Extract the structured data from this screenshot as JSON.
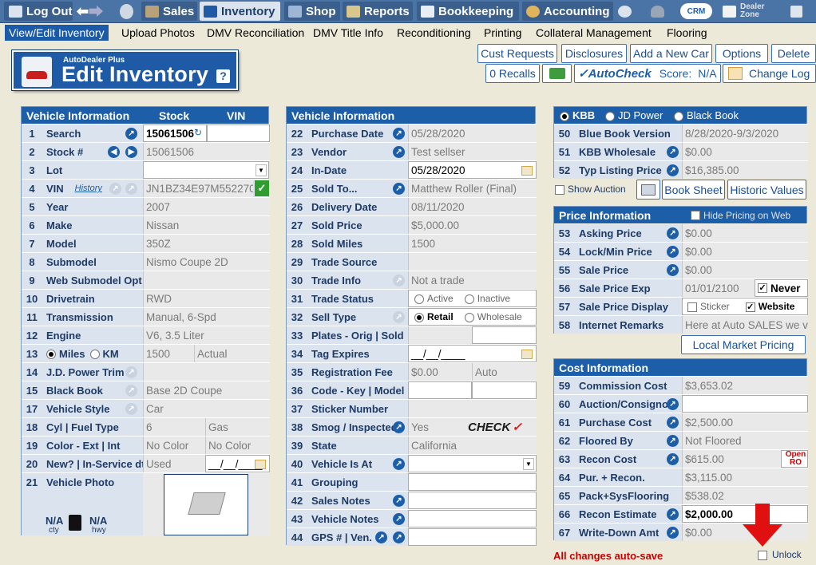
{
  "topnav": {
    "logout": "Log Out",
    "sales": "Sales",
    "inventory": "Inventory",
    "shop": "Shop",
    "reports": "Reports",
    "bookkeeping": "Bookkeeping",
    "accounting": "Accounting",
    "crm": "CRM",
    "dealer_zone": "Dealer Zone"
  },
  "subtabs": [
    "View/Edit Inventory",
    "Upload Photos",
    "DMV Reconciliation",
    "DMV Title Info",
    "Reconditioning",
    "Printing",
    "Collateral Management",
    "Flooring"
  ],
  "logo": {
    "small": "AutoDealer Plus",
    "title": "Edit Inventory",
    "help": "?"
  },
  "actions": {
    "cust_requests": "Cust Requests",
    "disclosures": "Disclosures",
    "add_new_car": "Add a New Car",
    "options": "Options",
    "delete": "Delete",
    "recalls": "0 Recalls",
    "autocheck": "✓AutoCheck",
    "score_label": "Score:",
    "score_value": "N/A",
    "change_log": "Change Log"
  },
  "left": {
    "header": "Vehicle Information",
    "col_stock": "Stock",
    "col_vin": "VIN",
    "history": "History",
    "miles": "Miles",
    "km": "KM",
    "actual": "Actual",
    "mpg_city": "N/A",
    "mpg_city_unit": "cty",
    "mpg_hwy": "N/A",
    "mpg_hwy_unit": "hwy",
    "rows": [
      {
        "n": "1",
        "label": "Search",
        "value": "15061506"
      },
      {
        "n": "2",
        "label": "Stock #",
        "value": "15061506"
      },
      {
        "n": "3",
        "label": "Lot",
        "value": ""
      },
      {
        "n": "4",
        "label": "VIN",
        "value": "JN1BZ34E97M552270"
      },
      {
        "n": "5",
        "label": "Year",
        "value": "2007"
      },
      {
        "n": "6",
        "label": "Make",
        "value": "Nissan"
      },
      {
        "n": "7",
        "label": "Model",
        "value": "350Z"
      },
      {
        "n": "8",
        "label": "Submodel",
        "value": "Nismo Coupe 2D"
      },
      {
        "n": "9",
        "label": "Web Submodel Opt",
        "value": ""
      },
      {
        "n": "10",
        "label": "Drivetrain",
        "value": "RWD"
      },
      {
        "n": "11",
        "label": "Transmission",
        "value": "Manual, 6-Spd"
      },
      {
        "n": "12",
        "label": "Engine",
        "value": "V6, 3.5 Liter"
      },
      {
        "n": "13",
        "label": "",
        "value": "1500"
      },
      {
        "n": "14",
        "label": "J.D. Power Trim",
        "value": ""
      },
      {
        "n": "15",
        "label": "Black Book",
        "value": "Base 2D Coupe"
      },
      {
        "n": "17",
        "label": "Vehicle Style",
        "value": "Car"
      },
      {
        "n": "18",
        "label": "Cyl | Fuel Type",
        "value": "6",
        "value2": "Gas"
      },
      {
        "n": "19",
        "label": "Color - Ext | Int",
        "value": "No Color",
        "value2": "No Color"
      },
      {
        "n": "20",
        "label": "New? | In-Service dt",
        "value": "Used",
        "value2": "__/__/____"
      },
      {
        "n": "21",
        "label": "Vehicle Photo",
        "value": ""
      }
    ]
  },
  "middle": {
    "header": "Vehicle Information",
    "check_text": "CHECK",
    "rows": [
      {
        "n": "22",
        "label": "Purchase Date",
        "value": "05/28/2020"
      },
      {
        "n": "23",
        "label": "Vendor",
        "value": "Test sellser"
      },
      {
        "n": "24",
        "label": "In-Date",
        "value": "05/28/2020"
      },
      {
        "n": "25",
        "label": "Sold To...",
        "value": "Matthew Roller (Final)"
      },
      {
        "n": "26",
        "label": "Delivery Date",
        "value": "08/11/2020"
      },
      {
        "n": "27",
        "label": "Sold Price",
        "value": "$5,000.00"
      },
      {
        "n": "28",
        "label": "Sold Miles",
        "value": "1500"
      },
      {
        "n": "29",
        "label": "Trade Source",
        "value": ""
      },
      {
        "n": "30",
        "label": "Trade Info",
        "value": "Not a trade"
      },
      {
        "n": "31",
        "label": "Trade Status",
        "value": "Active",
        "value2": "Inactive"
      },
      {
        "n": "32",
        "label": "Sell Type",
        "value": "Retail",
        "value2": "Wholesale"
      },
      {
        "n": "33",
        "label": "Plates - Orig | Sold",
        "value": ""
      },
      {
        "n": "34",
        "label": "Tag Expires",
        "value": "__/__/____"
      },
      {
        "n": "35",
        "label": "Registration Fee",
        "value": "$0.00",
        "value2": "Auto"
      },
      {
        "n": "36",
        "label": "Code - Key | Model",
        "value": ""
      },
      {
        "n": "37",
        "label": "Sticker Number",
        "value": ""
      },
      {
        "n": "38",
        "label": "Smog / Inspected",
        "value": "Yes"
      },
      {
        "n": "39",
        "label": "State",
        "value": "California"
      },
      {
        "n": "40",
        "label": "Vehicle Is At",
        "value": ""
      },
      {
        "n": "41",
        "label": "Grouping",
        "value": ""
      },
      {
        "n": "42",
        "label": "Sales Notes",
        "value": ""
      },
      {
        "n": "43",
        "label": "Vehicle Notes",
        "value": ""
      },
      {
        "n": "44",
        "label": "GPS # | Ven.",
        "value": ""
      }
    ]
  },
  "book": {
    "kbb": "KBB",
    "jdpower": "JD Power",
    "blackbook": "Black Book",
    "show_auction": "Show Auction",
    "book_sheet": "Book Sheet",
    "historic_values": "Historic Values",
    "rows": [
      {
        "n": "50",
        "label": "Blue Book Version",
        "value": "8/28/2020-9/3/2020"
      },
      {
        "n": "51",
        "label": "KBB Wholesale",
        "value": "$0.00"
      },
      {
        "n": "52",
        "label": "Typ Listing Price",
        "value": "$16,385.00"
      }
    ]
  },
  "price": {
    "header": "Price Information",
    "hide": "Hide Pricing on Web",
    "never": "Never",
    "sticker": "Sticker",
    "website": "Website",
    "local_market": "Local Market Pricing",
    "rows": [
      {
        "n": "53",
        "label": "Asking Price",
        "value": "$0.00"
      },
      {
        "n": "54",
        "label": "Lock/Min Price",
        "value": "$0.00"
      },
      {
        "n": "55",
        "label": "Sale Price",
        "value": "$0.00"
      },
      {
        "n": "56",
        "label": "Sale Price Exp",
        "value": "01/01/2100"
      },
      {
        "n": "57",
        "label": "Sale Price Display",
        "value": ""
      },
      {
        "n": "58",
        "label": "Internet Remarks",
        "value": "Here at Auto SALES we v"
      }
    ]
  },
  "cost": {
    "header": "Cost Information",
    "open_ro": "Open RO",
    "rows": [
      {
        "n": "59",
        "label": "Commission Cost",
        "value": "$3,653.02"
      },
      {
        "n": "60",
        "label": "Auction/Consignor",
        "value": ""
      },
      {
        "n": "61",
        "label": "Purchase Cost",
        "value": "$2,500.00"
      },
      {
        "n": "62",
        "label": "Floored By",
        "value": "Not Floored"
      },
      {
        "n": "63",
        "label": "Recon Cost",
        "value": "$615.00"
      },
      {
        "n": "64",
        "label": "Pur. + Recon.",
        "value": "$3,115.00"
      },
      {
        "n": "65",
        "label": "Pack+SysFlooring",
        "value": "$538.02"
      },
      {
        "n": "66",
        "label": "Recon Estimate",
        "value": "$2,000.00"
      },
      {
        "n": "67",
        "label": "Write-Down Amt",
        "value": "$0.00"
      }
    ]
  },
  "footer": {
    "autosave": "All changes auto-save",
    "unlock": "Unlock"
  },
  "colors": {
    "nav": "#4a74a6",
    "header": "#1d5ea9",
    "label_bg": "#dbe4ee",
    "accent_red": "#cc0000",
    "check_green": "#2e9e2e"
  }
}
